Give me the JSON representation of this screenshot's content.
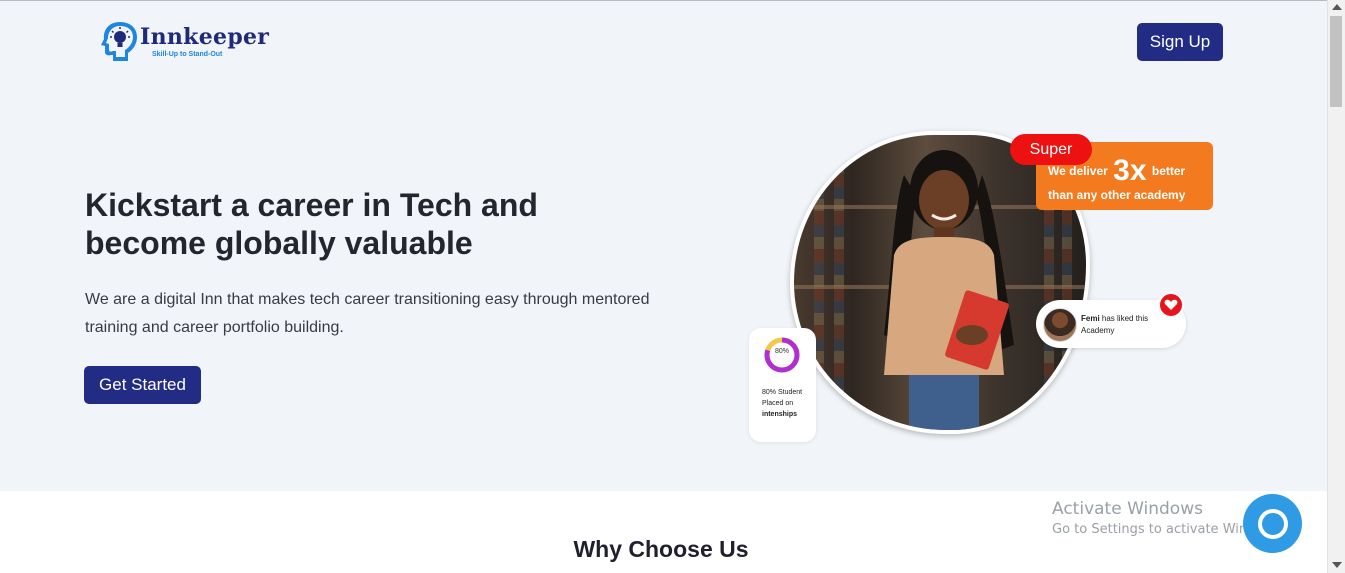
{
  "header": {
    "logo_name": "Innkeeper",
    "logo_tagline": "Skill-Up to Stand-Out",
    "signup_label": "Sign Up"
  },
  "hero": {
    "headline_line1": "Kickstart a career in Tech and",
    "headline_line2": "become globally valuable",
    "subtext": "We are a digital Inn that makes tech career transitioning easy through mentored training and career portfolio building.",
    "cta_label": "Get Started"
  },
  "badges": {
    "super": "Super",
    "deliver_prefix": "We deliver",
    "deliver_big": "3x",
    "deliver_suffix": "better",
    "deliver_line2": "than any other academy",
    "like_name": "Femi",
    "like_text": "has liked this Academy",
    "stat_percent_label": "80%",
    "stat_percent": 80,
    "stat_line1": "80% Student",
    "stat_line2": "Placed on",
    "stat_line3": "intenships"
  },
  "sections": {
    "why_title": "Why Choose Us"
  },
  "os_overlay": {
    "activate_title": "Activate Windows",
    "activate_sub": "Go to Settings to activate Windows."
  },
  "colors": {
    "brand_navy": "#232c84",
    "hero_bg": "#f1f4f8",
    "badge_red": "#ee1111",
    "card_orange": "#f47a1f",
    "chat_blue": "#2f9be4",
    "donut_purple": "#b02fd0",
    "donut_yellow": "#f2c94c"
  },
  "icons": {
    "logo": "head-lightbulb-logo-icon",
    "heart": "heart-icon",
    "chat": "chat-bubble-icon"
  }
}
